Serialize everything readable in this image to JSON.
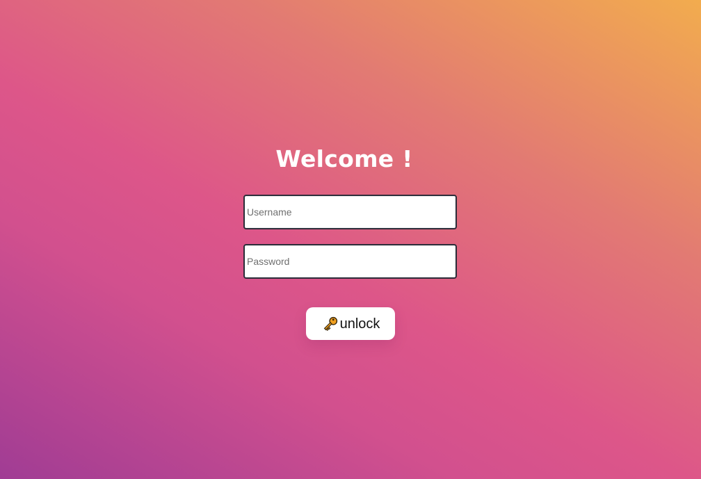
{
  "login": {
    "title": "Welcome !",
    "username_placeholder": "Username",
    "password_placeholder": "Password",
    "unlock_label": "unlock",
    "unlock_icon": "key-icon"
  },
  "colors": {
    "background_gradient": [
      "#a03c94",
      "#d2508e",
      "#dd5689",
      "#e27a73",
      "#f2ac4e"
    ],
    "title": "#ffffff",
    "field_border": "#2d2d3a",
    "button_background": "#ffffff",
    "key_icon": "#f0a020"
  }
}
